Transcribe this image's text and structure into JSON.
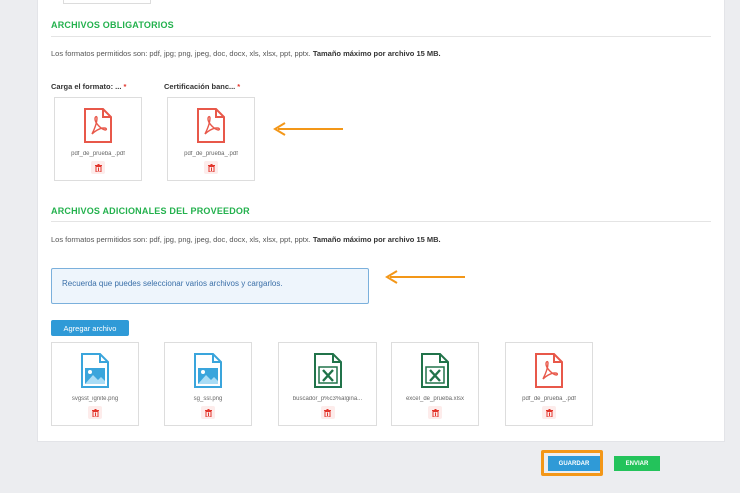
{
  "required_section": {
    "title": "ARCHIVOS OBLIGATORIOS",
    "formats_text": "Los formatos permitidos son: pdf, jpg; png, jpeg, doc, docx, xls, xlsx, ppt, pptx.",
    "max_size_text": "Tamaño máximo por archivo 15 MB.",
    "required_marker": "*",
    "fields": [
      {
        "label": "Carga el formato: ...",
        "file_name": "pdf_de_prueba_.pdf",
        "icon": "pdf-icon"
      },
      {
        "label": "Certificación banc...",
        "file_name": "pdf_de_prueba_.pdf",
        "icon": "pdf-icon"
      }
    ]
  },
  "additional_section": {
    "title": "ARCHIVOS ADICIONALES DEL PROVEEDOR",
    "formats_text": "Los formatos permitidos son: pdf, jpg, png, jpeg, doc, docx, xls, xlsx, ppt, pptx.",
    "max_size_text": "Tamaño máximo por archivo 15 MB.",
    "notice": "Recuerda que puedes seleccionar varios archivos y cargarlos.",
    "add_button": "Agregar archivo",
    "files": [
      {
        "file_name": "svgsst_ignite.png",
        "icon": "image-icon"
      },
      {
        "file_name": "sg_ssl.png",
        "icon": "image-icon"
      },
      {
        "file_name": "buscador_p%c3%algina...",
        "icon": "excel-icon"
      },
      {
        "file_name": "excel_de_prueba.xlsx",
        "icon": "excel-icon"
      },
      {
        "file_name": "pdf_de_prueba_.pdf",
        "icon": "pdf-icon"
      }
    ]
  },
  "footer": {
    "save_label": "GUARDAR",
    "send_label": "ENVIAR"
  },
  "colors": {
    "section_title": "#23b14d",
    "required": "#e2352b",
    "primary_button": "#2f9ad7",
    "send_button": "#23c35b",
    "highlight_arrow": "#f39718",
    "pdf": "#e8584a",
    "image": "#3aa5dc",
    "excel": "#21734a"
  }
}
